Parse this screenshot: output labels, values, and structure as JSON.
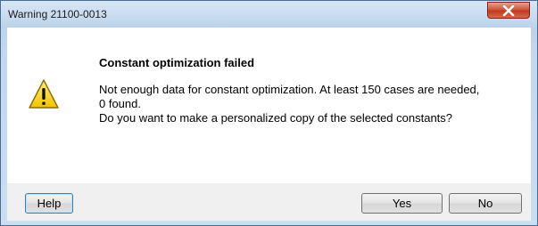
{
  "window": {
    "title": "Warning 21100-0013",
    "close_icon": "close-icon"
  },
  "dialog": {
    "icon": "warning-icon",
    "heading": "Constant optimization failed",
    "message": "Not enough data for constant optimization. At least 150 cases are needed,\n0 found.\nDo you want to make a personalized copy of the selected constants?"
  },
  "buttons": {
    "help": "Help",
    "yes": "Yes",
    "no": "No"
  }
}
